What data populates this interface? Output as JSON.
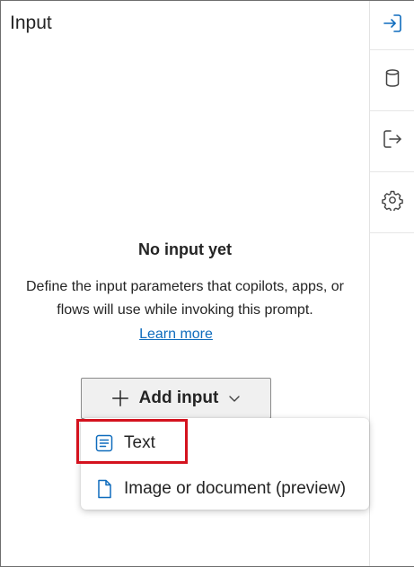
{
  "panel": {
    "title": "Input"
  },
  "rail": {
    "icons": [
      "sign-in-icon",
      "database-icon",
      "sign-out-icon",
      "settings-gear-icon"
    ],
    "accent": "#0f6cbd"
  },
  "empty_state": {
    "title": "No input yet",
    "description": "Define the input parameters that copilots, apps, or flows will use while invoking this prompt.",
    "learn_more": "Learn more"
  },
  "add_input": {
    "label": "Add input"
  },
  "menu": {
    "items": [
      {
        "label": "Text",
        "icon": "text-document-icon"
      },
      {
        "label": "Image or document (preview)",
        "icon": "document-icon"
      }
    ]
  },
  "highlight_color": "#d4121e"
}
